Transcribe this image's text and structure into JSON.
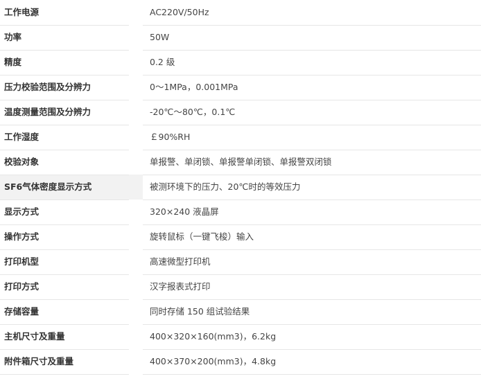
{
  "specs": [
    {
      "label": "工作电源",
      "value": "AC220V/50Hz"
    },
    {
      "label": "功率",
      "value": "50W"
    },
    {
      "label": "精度",
      "value": "0.2 级"
    },
    {
      "label": "压力校验范围及分辨力",
      "value": "0～1MPa，0.001MPa"
    },
    {
      "label": "温度测量范围及分辨力",
      "value": "-20℃～80℃，0.1℃"
    },
    {
      "label": "工作湿度",
      "value": "￡90%RH"
    },
    {
      "label": "校验对象",
      "value": "单报警、单闭锁、单报警单闭锁、单报警双闭锁"
    },
    {
      "label": "SF6气体密度显示方式",
      "value": "被测环境下的压力、20℃时的等效压力"
    },
    {
      "label": "显示方式",
      "value": "320×240 液晶屏"
    },
    {
      "label": "操作方式",
      "value": "旋转鼠标（一键飞梭）输入"
    },
    {
      "label": "打印机型",
      "value": "高速微型打印机"
    },
    {
      "label": "打印方式",
      "value": "汉字报表式打印"
    },
    {
      "label": "存储容量",
      "value": "同时存储 150 组试验结果"
    },
    {
      "label": "主机尺寸及重量",
      "value": "400×320×160(mm3)，6.2kg"
    },
    {
      "label": "附件箱尺寸及重量",
      "value": "400×370×200(mm3)，4.8kg"
    }
  ],
  "highlight_row_index": 7,
  "colors": {
    "label_text": "#333333",
    "value_text": "#444444",
    "divider": "#e6e6e6",
    "highlight_bg": "#f2f2f2"
  }
}
